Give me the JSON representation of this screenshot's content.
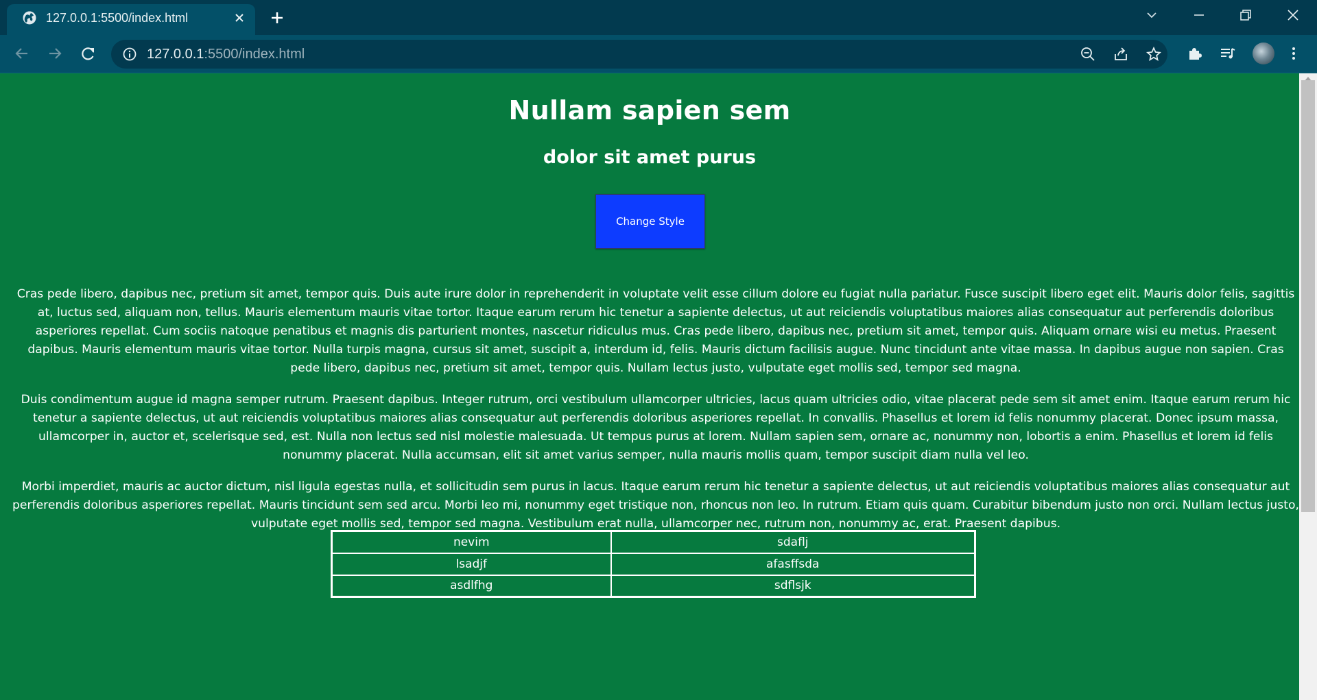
{
  "browser": {
    "tab_title": "127.0.0.1:5500/index.html",
    "url_host": "127.0.0.1",
    "url_rest": ":5500/index.html"
  },
  "page": {
    "heading": "Nullam sapien sem",
    "subheading": "dolor sit amet purus",
    "button_label": "Change Style",
    "paragraphs": [
      "Cras pede libero, dapibus nec, pretium sit amet, tempor quis. Duis aute irure dolor in reprehenderit in voluptate velit esse cillum dolore eu fugiat nulla pariatur. Fusce suscipit libero eget elit. Mauris dolor felis, sagittis at, luctus sed, aliquam non, tellus. Mauris elementum mauris vitae tortor. Itaque earum rerum hic tenetur a sapiente delectus, ut aut reiciendis voluptatibus maiores alias consequatur aut perferendis doloribus asperiores repellat. Cum sociis natoque penatibus et magnis dis parturient montes, nascetur ridiculus mus. Cras pede libero, dapibus nec, pretium sit amet, tempor quis. Aliquam ornare wisi eu metus. Praesent dapibus. Mauris elementum mauris vitae tortor. Nulla turpis magna, cursus sit amet, suscipit a, interdum id, felis. Mauris dictum facilisis augue. Nunc tincidunt ante vitae massa. In dapibus augue non sapien. Cras pede libero, dapibus nec, pretium sit amet, tempor quis. Nullam lectus justo, vulputate eget mollis sed, tempor sed magna.",
      "Duis condimentum augue id magna semper rutrum. Praesent dapibus. Integer rutrum, orci vestibulum ullamcorper ultricies, lacus quam ultricies odio, vitae placerat pede sem sit amet enim. Itaque earum rerum hic tenetur a sapiente delectus, ut aut reiciendis voluptatibus maiores alias consequatur aut perferendis doloribus asperiores repellat. In convallis. Phasellus et lorem id felis nonummy placerat. Donec ipsum massa, ullamcorper in, auctor et, scelerisque sed, est. Nulla non lectus sed nisl molestie malesuada. Ut tempus purus at lorem. Nullam sapien sem, ornare ac, nonummy non, lobortis a enim. Phasellus et lorem id felis nonummy placerat. Nulla accumsan, elit sit amet varius semper, nulla mauris mollis quam, tempor suscipit diam nulla vel leo.",
      "Morbi imperdiet, mauris ac auctor dictum, nisl ligula egestas nulla, et sollicitudin sem purus in lacus. Itaque earum rerum hic tenetur a sapiente delectus, ut aut reiciendis voluptatibus maiores alias consequatur aut perferendis doloribus asperiores repellat. Mauris tincidunt sem sed arcu. Morbi leo mi, nonummy eget tristique non, rhoncus non leo. In rutrum. Etiam quis quam. Curabitur bibendum justo non orci. Nullam lectus justo, vulputate eget mollis sed, tempor sed magna. Vestibulum erat nulla, ullamcorper nec, rutrum non, nonummy ac, erat. Praesent dapibus."
    ],
    "table": [
      [
        "nevim",
        "sdaflj"
      ],
      [
        "lsadjf",
        "afasffsda"
      ],
      [
        "asdlfhg",
        "sdflsjk"
      ]
    ]
  },
  "colors": {
    "page_background": "#067a3f",
    "button_background": "#0d3cff",
    "browser_frame": "#023a4f",
    "browser_toolbar": "#035068"
  }
}
